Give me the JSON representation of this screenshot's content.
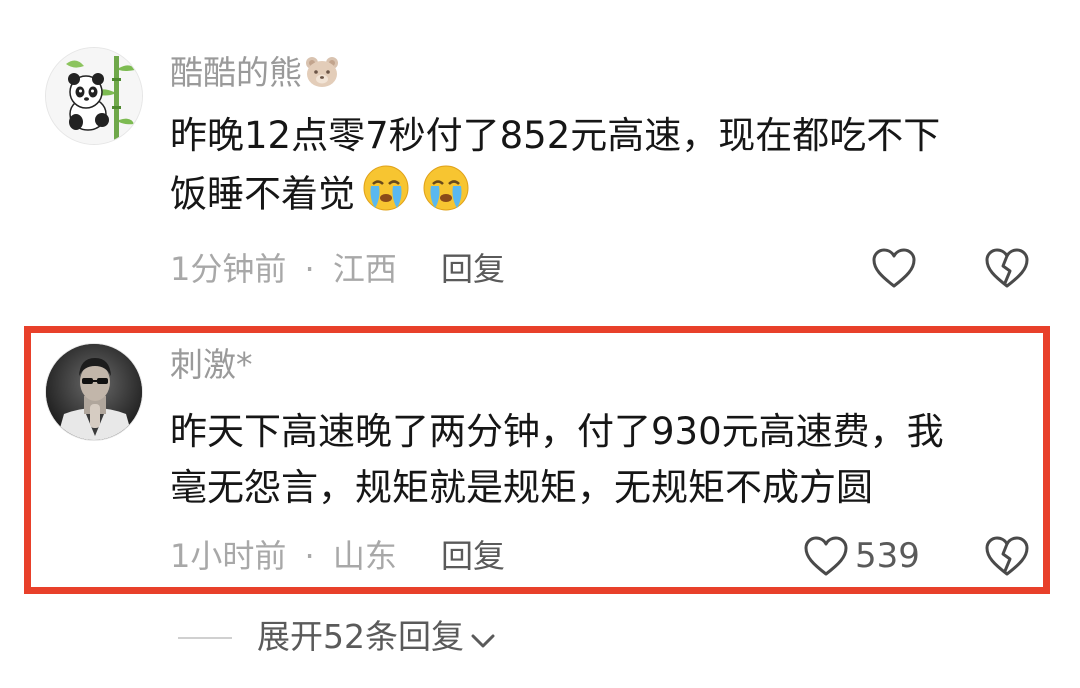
{
  "comments": [
    {
      "username": "酷酷的熊",
      "text_line1": "昨晚12点零7秒付了852元高速，现在都吃不下",
      "text_line2": "饭睡不着觉",
      "time": "1分钟前",
      "dot": "·",
      "location": "江西",
      "reply_label": "回复",
      "avatar_icon": "panda-avatar",
      "name_emoji_icon": "bear-face-icon",
      "text_emoji_icon": "crying-face-icon"
    },
    {
      "username": "刺激*",
      "text_line1": "昨天下高速晚了两分钟，付了930元高速费，我",
      "text_line2": "毫无怨言，规矩就是规矩，无规矩不成方圆",
      "time": "1小时前",
      "dot": "·",
      "location": "山东",
      "reply_label": "回复",
      "like_count": "539",
      "avatar_icon": "man-portrait-avatar"
    }
  ],
  "expand_replies_label": "展开52条回复",
  "colors": {
    "highlight_border": "#e8402a",
    "username": "#9a9a9a",
    "meta": "#a8a8a8"
  }
}
